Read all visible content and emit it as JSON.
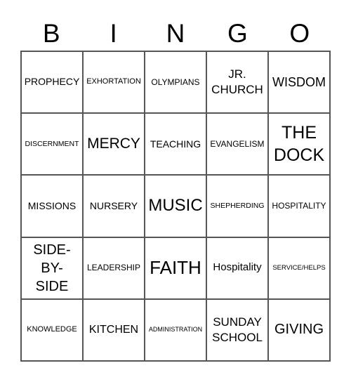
{
  "header": [
    "B",
    "I",
    "N",
    "G",
    "O"
  ],
  "cells": [
    "PROPHECY",
    "EXHORTATION",
    "OLYMPIANS",
    "JR. CHURCH",
    "WISDOM",
    "DISCERNMENT",
    "MERCY",
    "TEACHING",
    "EVANGELISM",
    "THE DOCK",
    "MISSIONS",
    "NURSERY",
    "MUSIC",
    "SHEPHERDING",
    "HOSPITALITY",
    "SIDE-BY-SIDE",
    "LEADERSHIP",
    "FAITH",
    "Hospitality",
    "SERVICE/HELPS",
    "KNOWLEDGE",
    "KITCHEN",
    "ADMINISTRATION",
    "SUNDAY SCHOOL",
    "GIVING"
  ]
}
